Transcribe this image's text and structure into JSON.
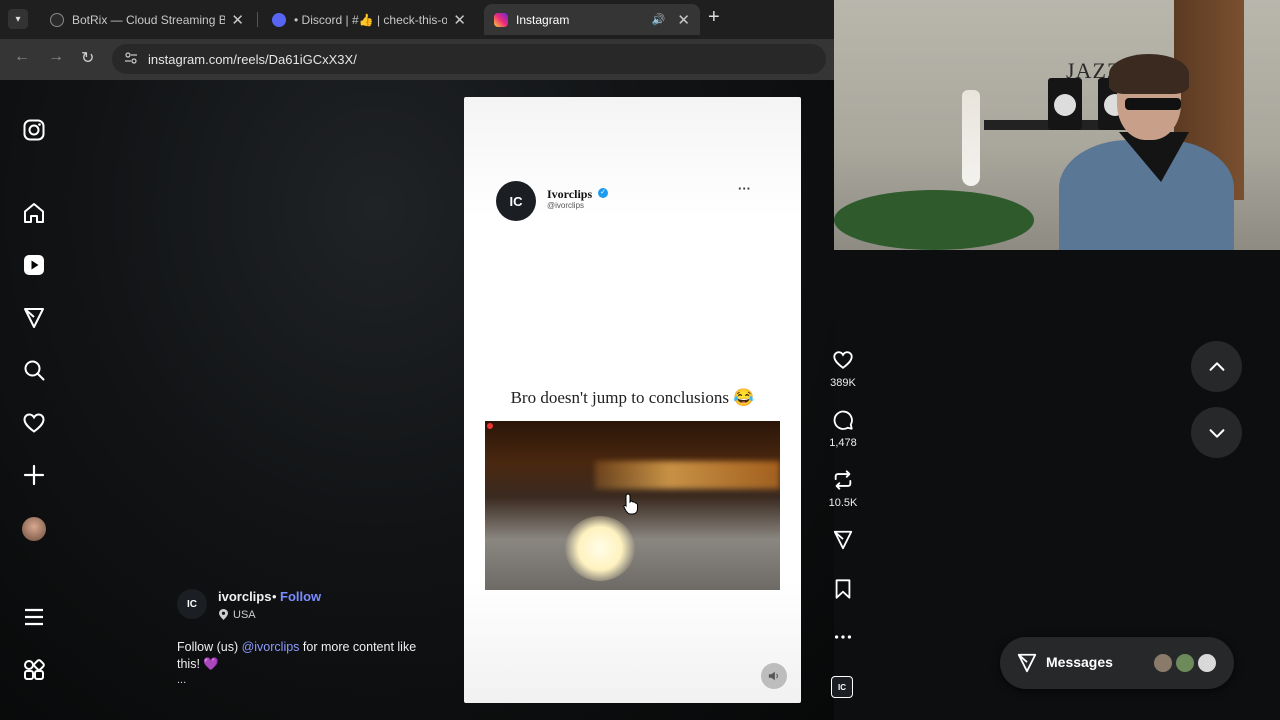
{
  "browser": {
    "tabs": [
      {
        "title": "BotRix — Cloud Streaming Bot",
        "active": false,
        "favicon_color": "#2a2a2a"
      },
      {
        "title": "• Discord | #👍 | check-this-out",
        "active": false,
        "favicon_color": "#5865f2"
      },
      {
        "title": "Instagram",
        "active": true,
        "favicon_color": "#e1306c"
      }
    ],
    "url": "instagram.com/reels/Da61iGCxX3X/"
  },
  "sidebar": {
    "items": [
      {
        "name": "instagram-logo-icon"
      },
      {
        "name": "home-icon"
      },
      {
        "name": "reels-icon"
      },
      {
        "name": "explore-icon"
      },
      {
        "name": "search-icon"
      },
      {
        "name": "notifications-heart-icon"
      },
      {
        "name": "create-plus-icon"
      },
      {
        "name": "profile-avatar"
      },
      {
        "name": "more-menu-icon"
      },
      {
        "name": "threads-apps-icon"
      }
    ]
  },
  "reel": {
    "post_name": "Ivorclips",
    "post_handle": "@ivorclips",
    "post_avatar_text": "IC",
    "caption_overlay": "Bro doesn't jump to conclusions 😂"
  },
  "account": {
    "username": "ivorclips",
    "separator": "•",
    "follow_label": "Follow",
    "location": "USA",
    "description_prefix": "Follow (us) ",
    "description_mention": "@ivorclips",
    "description_suffix": " for more content like this! 💜",
    "more": "..."
  },
  "actions": {
    "likes": "389K",
    "comments": "1,478",
    "reposts": "10.5K"
  },
  "messages": {
    "label": "Messages"
  },
  "webcam": {
    "sign_text": "JAZZ"
  },
  "colors": {
    "accent_link": "#7a8cff",
    "verified": "#1d9bf0",
    "panel": "#262829"
  }
}
